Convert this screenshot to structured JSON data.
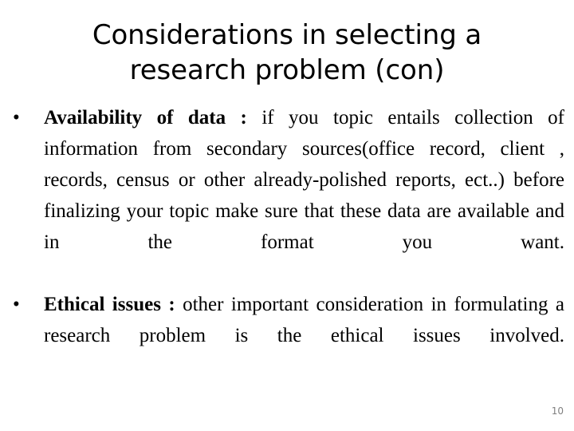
{
  "slide": {
    "background_color": "#ffffff",
    "text_color": "#000000",
    "title": {
      "line1": "Considerations in selecting a",
      "line2": "research problem (con)"
    },
    "bullets": [
      {
        "marker": "•",
        "lead": "Availability of data : ",
        "body": "if you topic entails collection of information from secondary sources(office record, client , records, census or other already-polished reports, ect..) before finalizing your topic make sure that these data are available and in the format you want."
      },
      {
        "marker": "•",
        "lead": "Ethical issues : ",
        "body": "other important consideration in formulating a research problem is the ethical issues involved."
      }
    ],
    "page_number": "10",
    "page_number_color": "#808080"
  }
}
